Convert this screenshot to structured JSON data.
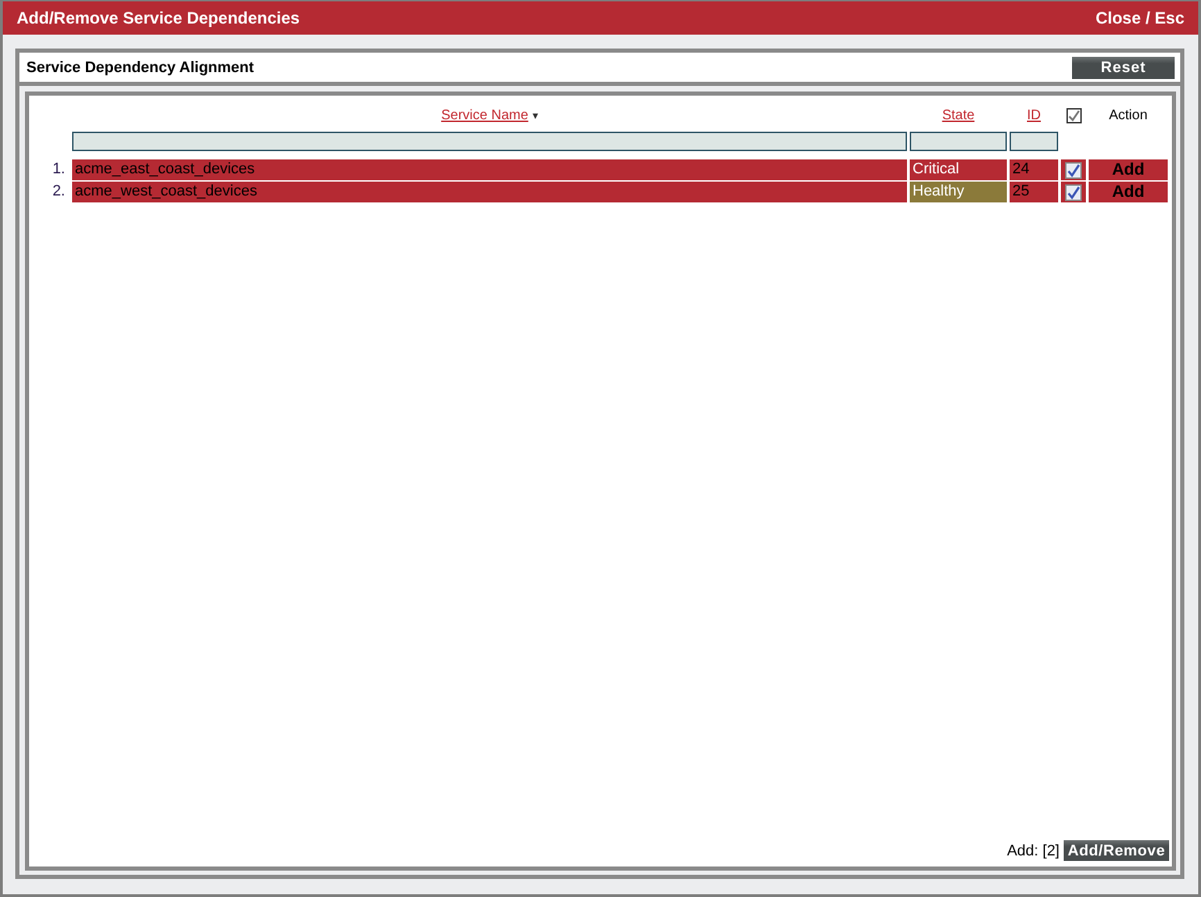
{
  "window": {
    "title": "Add/Remove Service Dependencies",
    "close": "Close / Esc"
  },
  "panel": {
    "title": "Service Dependency Alignment",
    "reset": "Reset"
  },
  "table": {
    "columns": [
      {
        "label": "Service Name",
        "sort_mark": "▾"
      },
      {
        "label": "State"
      },
      {
        "label": "ID"
      },
      {
        "checked": true
      },
      {
        "label": "Action"
      }
    ],
    "rows": [
      {
        "index": "1.",
        "name": "acme_east_coast_devices",
        "state": "Critical",
        "color": "#b52a33",
        "id": "24",
        "checked": true,
        "action": "Add"
      },
      {
        "index": "2.",
        "name": "acme_west_coast_devices",
        "state": "Healthy",
        "color": "#8b7a3a",
        "id": "25",
        "checked": true,
        "action": "Add"
      }
    ]
  },
  "footer": {
    "count": "Add: [2]",
    "button": "Add/Remove"
  }
}
